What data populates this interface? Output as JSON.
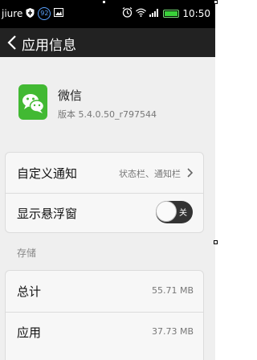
{
  "status_bar": {
    "carrier": "jiure",
    "badge": "92",
    "time": "10:50"
  },
  "title_bar": {
    "title": "应用信息"
  },
  "app": {
    "name": "微信",
    "version": "版本 5.4.0.50_r797544"
  },
  "settings": {
    "custom_notify_label": "自定义通知",
    "custom_notify_value": "状态栏、通知栏",
    "floating_window_label": "显示悬浮窗",
    "floating_window_toggle": "关"
  },
  "storage": {
    "section_label": "存储",
    "total_label": "总计",
    "total_value": "55.71 MB",
    "app_label": "应用",
    "app_value": "37.73 MB"
  },
  "colors": {
    "status_bar": "#000000",
    "title_bar": "#222222",
    "wechat_green": "#42b933",
    "page_bg": "#efefef"
  }
}
